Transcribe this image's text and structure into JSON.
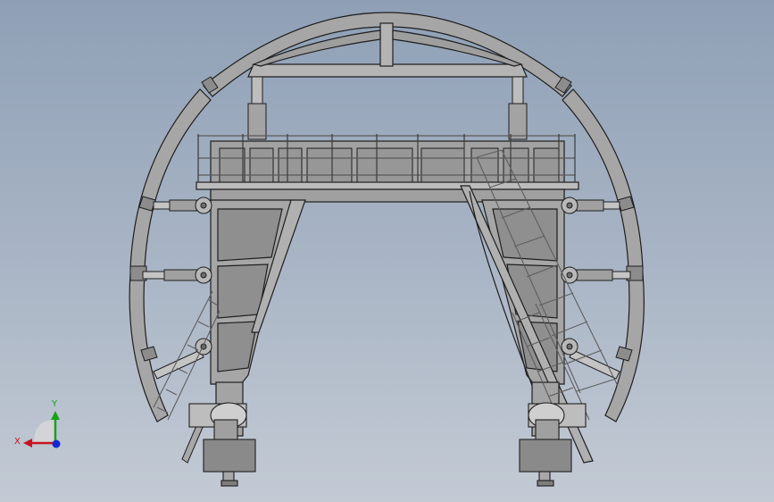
{
  "viewport": {
    "background_top": "#8fa0b6",
    "background_bottom": "#c3cad4",
    "part_fill": "#a6a6a6",
    "part_dark": "#8c8c8c",
    "edge": "#1e1e1e"
  },
  "triad": {
    "x_label": "X",
    "y_label": "Y",
    "x_color": "#c8141e",
    "y_color": "#1aa01a",
    "z_color": "#1428d2"
  }
}
